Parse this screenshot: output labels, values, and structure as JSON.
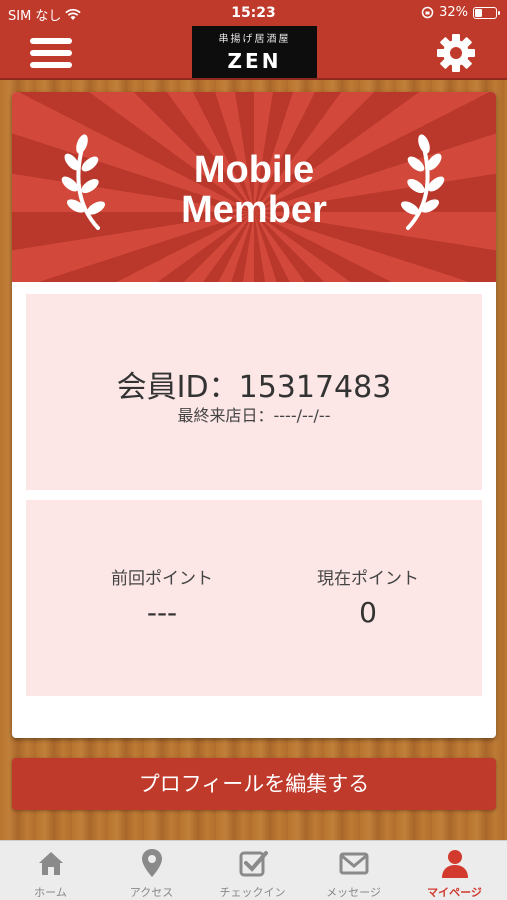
{
  "status_bar": {
    "carrier": "SIM なし",
    "time": "15:23",
    "battery": "32%",
    "battery_level": 0.32,
    "icons": [
      "wifi-icon",
      "rotation-lock-icon",
      "battery-icon"
    ]
  },
  "header": {
    "logo_sub": "串揚げ居酒屋",
    "logo_main": "ZEN",
    "icons": [
      "hamburger-menu-icon",
      "gear-icon"
    ]
  },
  "banner": {
    "line1": "Mobile",
    "line2": "Member"
  },
  "member": {
    "id_text": "会員ID：15317483",
    "last_visit": "最終来店日：----/--/--"
  },
  "points": {
    "previous_label": "前回ポイント",
    "previous_value": "---",
    "current_label": "現在ポイント",
    "current_value": "0"
  },
  "edit_profile_label": "プロフィールを編集する",
  "tabs": [
    {
      "label": "ホーム",
      "icon": "home-icon"
    },
    {
      "label": "アクセス",
      "icon": "map-pin-icon"
    },
    {
      "label": "チェックイン",
      "icon": "checkbox-icon"
    },
    {
      "label": "メッセージ",
      "icon": "envelope-icon"
    },
    {
      "label": "マイページ",
      "icon": "user-icon",
      "active": true
    }
  ],
  "colors": {
    "brand_red": "#c03a2b",
    "panel_pink": "#fce6e6",
    "active_tab": "#d23a2e",
    "inactive_tab": "#888888"
  }
}
